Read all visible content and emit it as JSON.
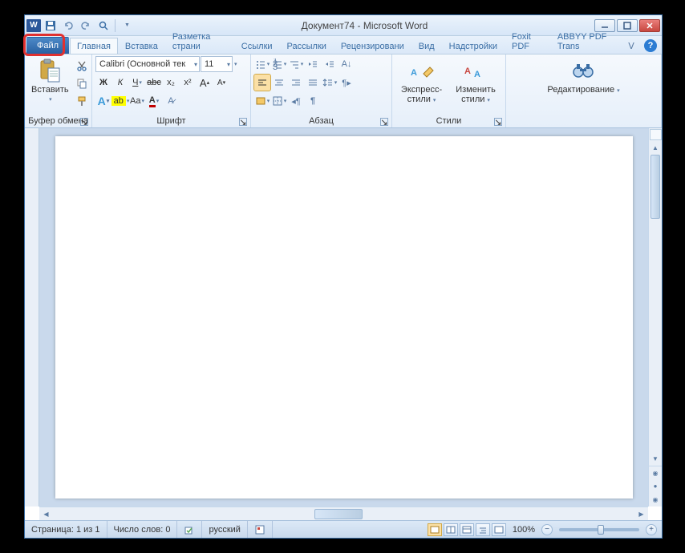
{
  "title": "Документ74  -  Microsoft Word",
  "tabs": {
    "file": "Файл",
    "items": [
      "Главная",
      "Вставка",
      "Разметка страни",
      "Ссылки",
      "Рассылки",
      "Рецензировани",
      "Вид",
      "Надстройки",
      "Foxit PDF",
      "ABBYY PDF Trans"
    ]
  },
  "ribbon": {
    "clipboard": {
      "paste": "Вставить",
      "label": "Буфер обмена"
    },
    "font": {
      "name": "Calibri (Основной тек",
      "size": "11",
      "label": "Шрифт",
      "bold": "Ж",
      "italic": "К",
      "underline": "Ч",
      "strike": "abc",
      "sub": "x₂",
      "sup": "x²"
    },
    "paragraph": {
      "label": "Абзац"
    },
    "styles": {
      "quick": "Экспресс-стили",
      "change": "Изменить стили",
      "label": "Стили"
    },
    "editing": {
      "label": "Редактирование"
    }
  },
  "status": {
    "page": "Страница: 1 из 1",
    "words": "Число слов: 0",
    "lang": "русский",
    "zoom": "100%"
  }
}
